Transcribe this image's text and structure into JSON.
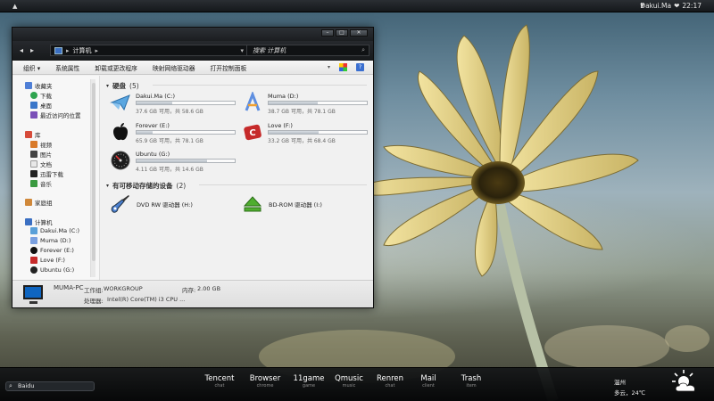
{
  "topbar": {
    "user": "Dakui.Ma",
    "heart": "❤",
    "time": "22:17"
  },
  "window": {
    "address_path": "计算机",
    "search_placeholder": "搜索 计算机",
    "toolbar": [
      "组织",
      "系统属性",
      "卸载或更改程序",
      "映射网络驱动器",
      "打开控制面板"
    ],
    "sidebar": {
      "favorites": {
        "label": "收藏夹",
        "items": [
          "下载",
          "桌面",
          "最近访问的位置"
        ]
      },
      "libraries": {
        "label": "库",
        "items": [
          "视频",
          "图片",
          "文档",
          "迅雷下载",
          "音乐"
        ]
      },
      "homegroup": "家庭组",
      "computer": {
        "label": "计算机",
        "items": [
          "Dakui.Ma (C:)",
          "Muma (D:)",
          "Forever (E:)",
          "Love (F:)",
          "Ubuntu (G:)"
        ]
      }
    },
    "groups": {
      "hdd": {
        "title": "硬盘",
        "count": "(5)"
      },
      "removable": {
        "title": "有可移动存储的设备",
        "count": "(2)"
      }
    },
    "drives": [
      {
        "name": "Dakui.Ma (C:)",
        "info": "37.6 GB 可用，共 58.6 GB",
        "used_fraction": 0.36,
        "icon": "paper-plane-icon"
      },
      {
        "name": "Muma (D:)",
        "info": "38.7 GB 可用，共 78.1 GB",
        "used_fraction": 0.5,
        "icon": "app-store-icon"
      },
      {
        "name": "Forever (E:)",
        "info": "65.9 GB 可用，共 78.1 GB",
        "used_fraction": 0.16,
        "icon": "apple-icon"
      },
      {
        "name": "Love (F:)",
        "info": "33.2 GB 可用，共 68.4 GB",
        "used_fraction": 0.51,
        "icon": "red-app-icon"
      },
      {
        "name": "Ubuntu (G:)",
        "info": "4.11 GB 可用，共 14.6 GB",
        "used_fraction": 0.72,
        "icon": "dashboard-icon"
      }
    ],
    "devices": [
      {
        "name": "DVD RW 驱动器 (H:)",
        "icon": "guitar-icon"
      },
      {
        "name": "BD-ROM 驱动器 (I:)",
        "icon": "eject-icon"
      }
    ],
    "details": {
      "pc_name": "MUMA-PC",
      "workgroup_label": "工作组:",
      "workgroup": "WORKGROUP",
      "memory_label": "内存:",
      "memory": "2.00 GB",
      "cpu_label": "处理器:",
      "cpu": "Intel(R) Core(TM) i3 CPU ..."
    }
  },
  "dock": {
    "search": "Baidu",
    "apps": [
      {
        "name": "Tencent",
        "sub": "chat"
      },
      {
        "name": "Browser",
        "sub": "chrome"
      },
      {
        "name": "11game",
        "sub": "game"
      },
      {
        "name": "Qmusic",
        "sub": "music"
      },
      {
        "name": "Renren",
        "sub": "chat"
      },
      {
        "name": "Mail",
        "sub": "client"
      },
      {
        "name": "Trash",
        "sub": "item"
      }
    ],
    "weather": {
      "city": "温州",
      "condition": "多云，24℃"
    }
  },
  "colors": {
    "window_dark": "#1b1d20",
    "dock_bg": "#0b0c0d",
    "accent_blue": "#0f65c0"
  }
}
